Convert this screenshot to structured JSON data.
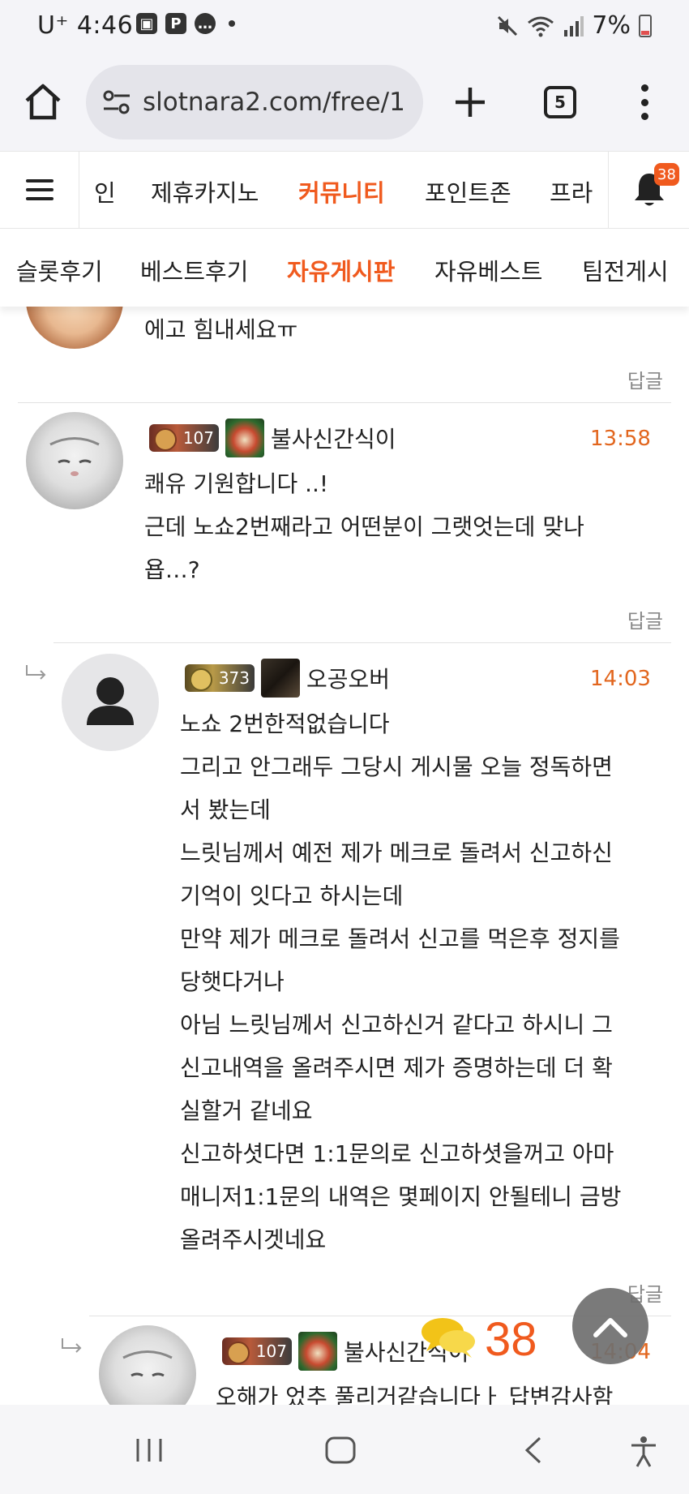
{
  "status_bar": {
    "time": "4:46",
    "carrier": "U⁺",
    "notif_icons": [
      "image-icon",
      "p-icon",
      "chat-icon"
    ],
    "battery": "7%"
  },
  "browser": {
    "url": "slotnara2.com/free/1",
    "tab_count": "5"
  },
  "site_nav": {
    "items": [
      "인",
      "제휴카지노",
      "커뮤니티",
      "포인트존",
      "프라"
    ],
    "active": "커뮤니티",
    "notification_count": "38"
  },
  "sub_nav": {
    "items": [
      "슬롯후기",
      "베스트후기",
      "자유게시판",
      "자유베스트",
      "팀전게시"
    ],
    "active": "자유게시판"
  },
  "comments": [
    {
      "body": [
        "에고 힘내세요ㅠ"
      ],
      "reply_label": "답글"
    },
    {
      "level": "107",
      "author": "불사신간식이",
      "time": "13:58",
      "body": [
        "쾌유 기원합니다 ..!",
        "근데 노쇼2번째라고 어떤분이 그랫엇는데 맞나",
        "욥…?"
      ],
      "reply_label": "답글"
    },
    {
      "level": "373",
      "author": "오공오버",
      "time": "14:03",
      "body": [
        "노쇼 2번한적없습니다",
        "그리고 안그래두 그당시 게시물 오늘 정독하면",
        "서 봤는데",
        "느릿님께서 예전 제가 메크로 돌려서 신고하신",
        "기억이 잇다고 하시는데",
        "만약 제가 메크로 돌려서 신고를 먹은후 정지를",
        "당햇다거나",
        "아님 느릿님께서 신고하신거 같다고 하시니 그",
        "신고내역을 올려주시면 제가 증명하는데 더 확",
        "실할거 같네요",
        "신고하셧다면 1:1문의로 신고하셧을꺼고 아마",
        "매니저1:1문의 내역은 몇페이지 안될테니 금방",
        "올려주시겟네요"
      ],
      "reply_label": "답글"
    },
    {
      "level": "107",
      "author": "불사신간식이",
      "time": "14:04",
      "body": [
        "오해가 었추 풀리거같습니다ㅏ 답변감사함"
      ]
    }
  ],
  "floating": {
    "comment_count": "38"
  },
  "colors": {
    "accent": "#f05a1e",
    "time": "#e2661e"
  }
}
